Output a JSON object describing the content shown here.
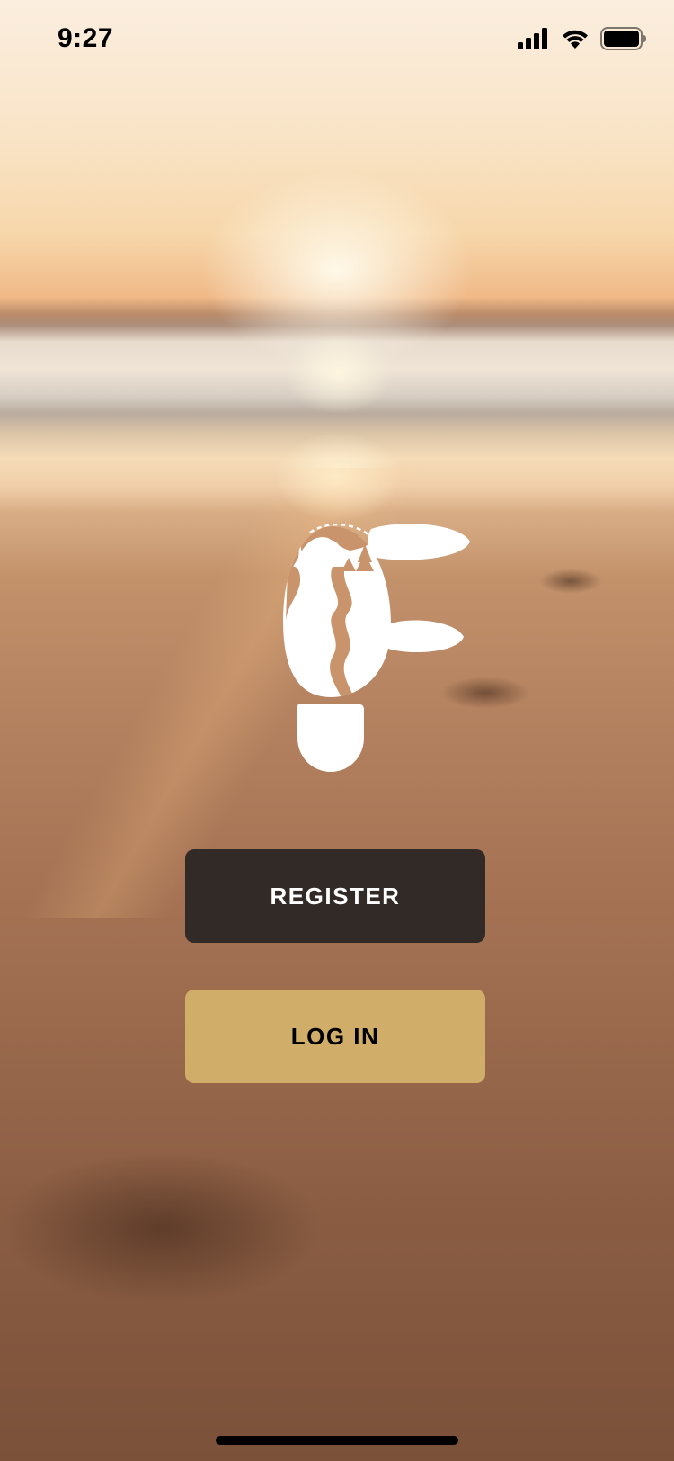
{
  "status_bar": {
    "time": "9:27",
    "icons": [
      "cellular-signal-icon",
      "wifi-icon",
      "battery-icon"
    ]
  },
  "logo": {
    "icon": "footprint-logo-icon",
    "color": "#ffffff"
  },
  "buttons": {
    "register_label": "REGISTER",
    "login_label": "LOG IN"
  },
  "colors": {
    "register_bg": "#322a27",
    "login_bg": "#d0ae6a"
  }
}
